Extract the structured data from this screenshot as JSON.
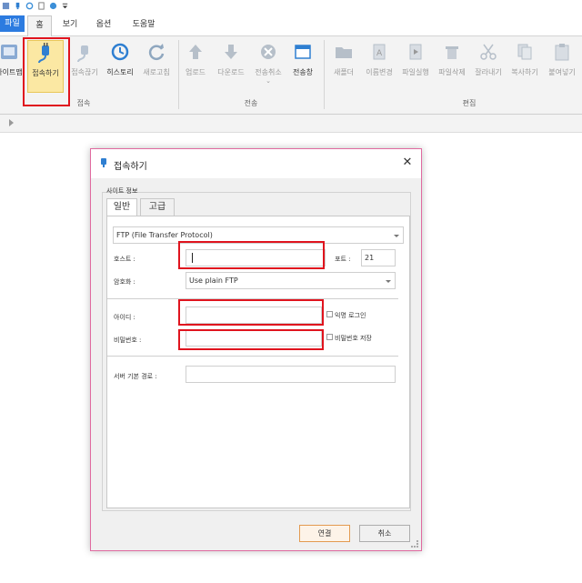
{
  "quick_access": {
    "icons": [
      "app-icon",
      "connect-icon",
      "refresh-icon",
      "file-icon",
      "globe-icon",
      "dropdown-icon"
    ]
  },
  "tabs": {
    "file": "파일",
    "home": "홈",
    "view": "보기",
    "options": "옵션",
    "help": "도움말"
  },
  "ribbon": {
    "site": "사이트맵",
    "connect": "접속하기",
    "disconnect": "접속끊기",
    "history": "히스토리",
    "refresh": "새로고침",
    "upload": "업로드",
    "download": "다운로드",
    "cancel_transfer": "전송취소",
    "transfer_window": "전송창",
    "new_folder": "새폴더",
    "rename": "이름변경",
    "run_file": "파일실행",
    "delete_file": "파일삭제",
    "cut": "잘라내기",
    "copy": "복사하기",
    "paste": "붙여넣기",
    "group_connect": "접속",
    "group_transfer": "전송",
    "group_edit": "편집"
  },
  "dialog": {
    "title": "접속하기",
    "close": "✕",
    "group_label": "사이트 정보",
    "tab_general": "일반",
    "tab_advanced": "고급",
    "protocol": "FTP (File Transfer Protocol)",
    "host_label": "호스트 :",
    "host_value": "",
    "port_label": "포트 :",
    "port_value": "21",
    "encryption_label": "암호화 :",
    "encryption_value": "Use plain FTP",
    "id_label": "아이디 :",
    "anonymous_label": "익명 로그인",
    "password_label": "비밀번호 :",
    "save_password_label": "비밀번호 저장",
    "server_path_label": "서버 기본 경로 :",
    "server_path_value": "",
    "ok": "연결",
    "cancel": "취소"
  },
  "colors": {
    "accent": "#2c7be0",
    "highlight": "#e0141e",
    "selected": "#fbe8a3"
  }
}
